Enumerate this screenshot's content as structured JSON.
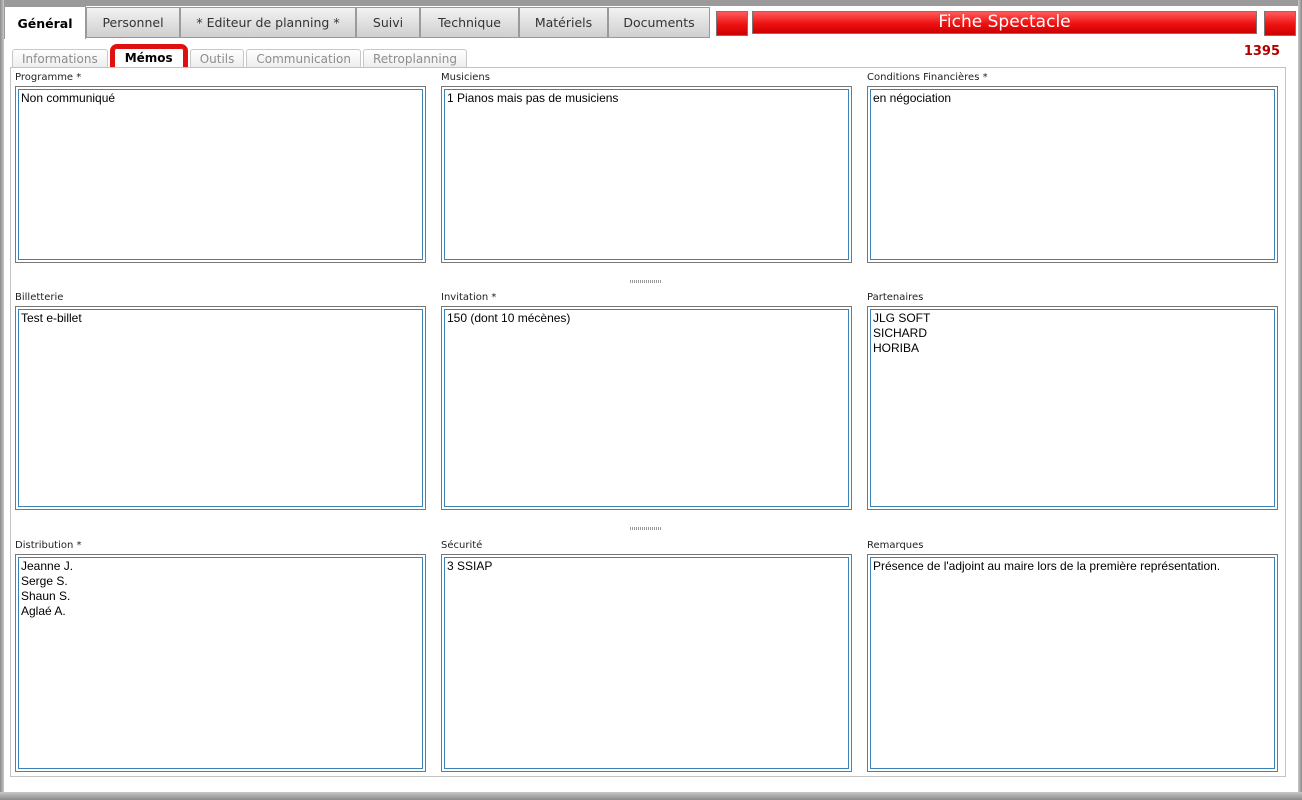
{
  "main_tabs": [
    {
      "label": "Général",
      "active": true
    },
    {
      "label": "Personnel",
      "active": false
    },
    {
      "label": "* Editeur de planning *",
      "active": false
    },
    {
      "label": "Suivi",
      "active": false
    },
    {
      "label": "Technique",
      "active": false
    },
    {
      "label": "Matériels",
      "active": false
    },
    {
      "label": "Documents",
      "active": false
    }
  ],
  "header": {
    "title": "Fiche Spectacle",
    "record_id": "1395",
    "accent_color": "#ee1111"
  },
  "sub_tabs": [
    {
      "label": "Informations",
      "active": false
    },
    {
      "label": "Mémos",
      "active": true
    },
    {
      "label": "Outils",
      "active": false
    },
    {
      "label": "Communication",
      "active": false
    },
    {
      "label": "Retroplanning",
      "active": false
    }
  ],
  "memos": {
    "programme": {
      "label": "Programme *",
      "value": "Non communiqué"
    },
    "musiciens": {
      "label": "Musiciens",
      "value": "1 Pianos mais pas de musiciens"
    },
    "conditions": {
      "label": "Conditions Financières *",
      "value": "en négociation"
    },
    "billetterie": {
      "label": "Billetterie",
      "value": "Test e-billet"
    },
    "invitation": {
      "label": "Invitation *",
      "value": "150 (dont 10 mécènes)"
    },
    "partenaires": {
      "label": "Partenaires",
      "value": "JLG SOFT\nSICHARD\nHORIBA"
    },
    "distribution": {
      "label": "Distribution *",
      "value": "Jeanne J.\nSerge S.\nShaun S.\nAglaé A."
    },
    "securite": {
      "label": "Sécurité",
      "value": "3 SSIAP"
    },
    "remarques": {
      "label": "Remarques",
      "value": "Présence de l'adjoint au maire lors de la première représentation."
    }
  }
}
